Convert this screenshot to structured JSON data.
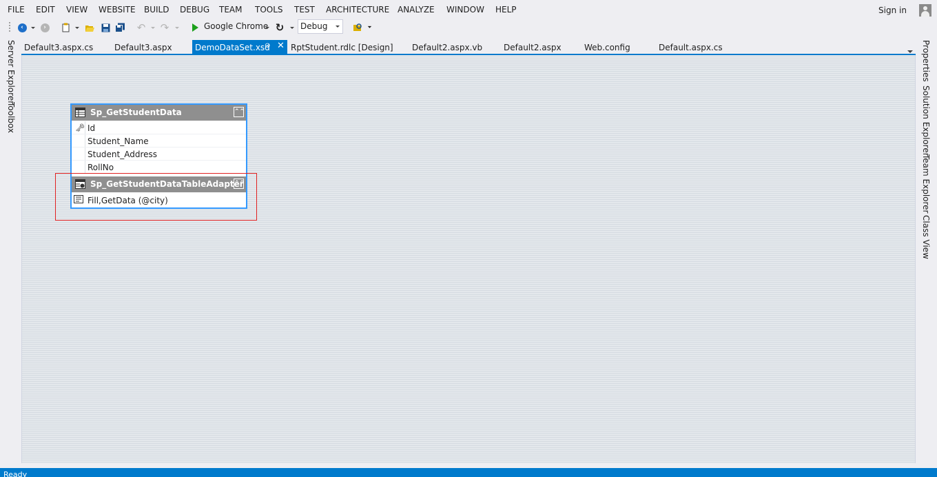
{
  "menu": {
    "items": [
      "FILE",
      "EDIT",
      "VIEW",
      "WEBSITE",
      "BUILD",
      "DEBUG",
      "TEAM",
      "TOOLS",
      "TEST",
      "ARCHITECTURE",
      "ANALYZE",
      "WINDOW",
      "HELP"
    ],
    "sign_in": "Sign in"
  },
  "toolbar": {
    "run_target": "Google Chrome",
    "configuration": "Debug"
  },
  "left_panels": [
    "Server Explorer",
    "Toolbox"
  ],
  "right_panels": [
    "Properties",
    "Solution Explorer",
    "Team Explorer",
    "Class View"
  ],
  "tabs": [
    {
      "label": "Default3.aspx.cs",
      "active": false
    },
    {
      "label": "Default3.aspx",
      "active": false
    },
    {
      "label": "DemoDataSet.xsd",
      "active": true
    },
    {
      "label": "RptStudent.rdlc [Design]",
      "active": false
    },
    {
      "label": "Default2.aspx.vb",
      "active": false
    },
    {
      "label": "Default2.aspx",
      "active": false
    },
    {
      "label": "Web.config",
      "active": false
    },
    {
      "label": "Default.aspx.cs",
      "active": false
    }
  ],
  "datatable": {
    "name": "Sp_GetStudentData",
    "columns": [
      "Id",
      "Student_Name",
      "Student_Address",
      "RollNo"
    ],
    "primary_key": "Id",
    "adapter": {
      "name": "Sp_GetStudentDataTableAdapter",
      "query": "Fill,GetData (@city)"
    }
  },
  "colors": {
    "accent": "#007acc",
    "selection_border": "#3399ff",
    "highlight_border": "#e12020",
    "header_gray": "#8f8f8f"
  },
  "status": {
    "text": "Ready"
  }
}
